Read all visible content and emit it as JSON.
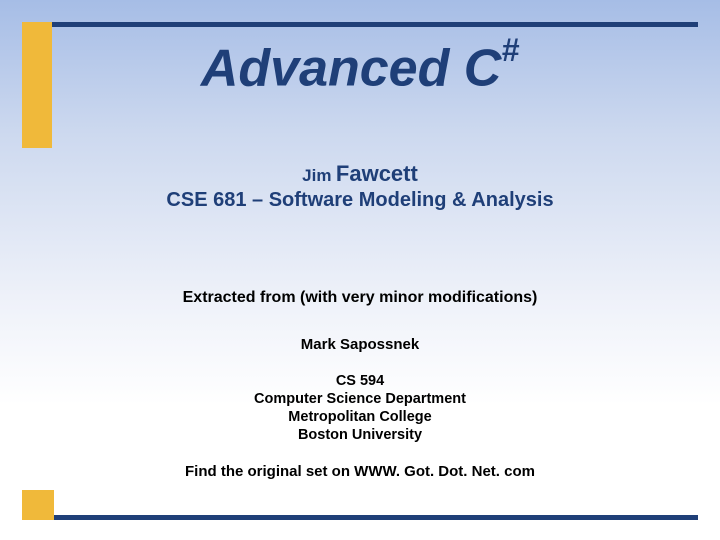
{
  "title": {
    "main": "Advanced C",
    "sup": "#"
  },
  "author": {
    "first": "Jim",
    "last": "Fawcett"
  },
  "course": "CSE 681 – Software Modeling & Analysis",
  "extracted": "Extracted from (with very minor modifications)",
  "original_author": "Mark Sapossnek",
  "affiliation": {
    "line1": "CS 594",
    "line2": "Computer Science Department",
    "line3": "Metropolitan College",
    "line4": "Boston University"
  },
  "find_original": "Find the original set on WWW. Got. Dot. Net. com"
}
